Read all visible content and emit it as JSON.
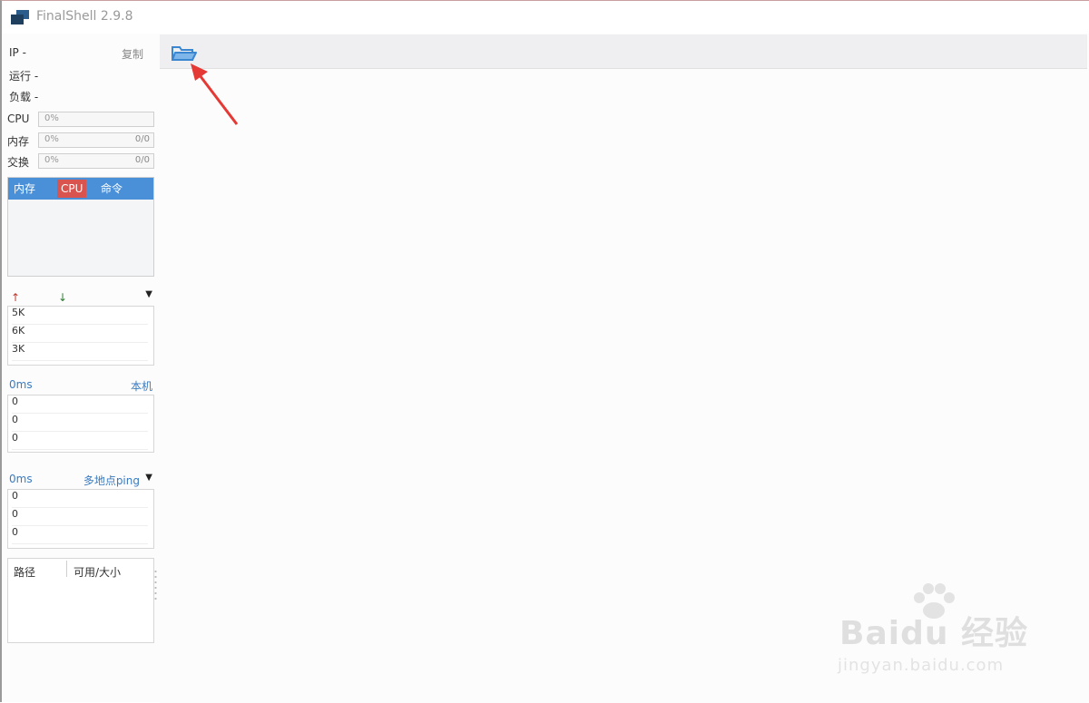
{
  "window": {
    "title": "FinalShell 2.9.8"
  },
  "sidebar": {
    "info": [
      {
        "label": "IP -"
      },
      {
        "label": "运行 -"
      },
      {
        "label": "负载 -"
      }
    ],
    "copy_label": "复制",
    "meters": [
      {
        "label": "CPU",
        "value": "0%",
        "extra": ""
      },
      {
        "label": "内存",
        "value": "0%",
        "extra": "0/0"
      },
      {
        "label": "交换",
        "value": "0%",
        "extra": "0/0"
      }
    ],
    "tabs": [
      {
        "label": "内存",
        "active": false
      },
      {
        "label": "CPU",
        "active": true
      },
      {
        "label": "命令",
        "active": false
      }
    ],
    "network": {
      "up_arrow": "↑",
      "down_arrow": "↓",
      "dropdown": "▼",
      "rows": [
        "5K",
        "6K",
        "3K"
      ]
    },
    "ping_local": {
      "left": "0ms",
      "right": "本机",
      "rows": [
        "0",
        "0",
        "0"
      ]
    },
    "ping_multi": {
      "left": "0ms",
      "right": "多地点ping",
      "dropdown": "▼",
      "rows": [
        "0",
        "0",
        "0"
      ]
    },
    "disk": {
      "col_path": "路径",
      "col_size": "可用/大小"
    }
  },
  "toolbar": {
    "folder_icon": "folder-open-icon"
  },
  "watermark": {
    "main": "Baidu 经验",
    "sub": "jingyan.baidu.com"
  },
  "colors": {
    "tab_strip": "#4a90d9",
    "tab_active": "#d9534f",
    "arrow_up": "#c0392b",
    "arrow_down": "#2e7d32",
    "ping_text": "#3a7bbf",
    "annotation": "#e53935"
  }
}
